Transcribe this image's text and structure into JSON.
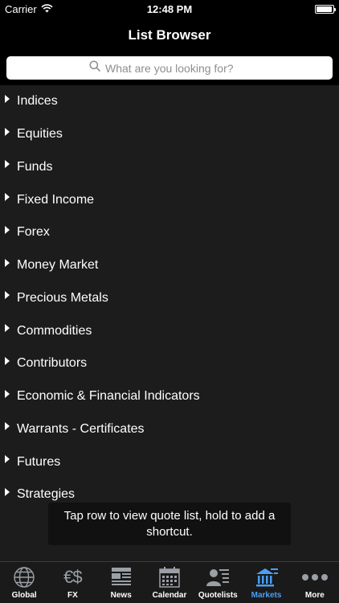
{
  "status": {
    "carrier": "Carrier",
    "time": "12:48 PM",
    "battery_level": 0.95
  },
  "nav": {
    "title": "List Browser"
  },
  "search": {
    "placeholder": "What are you looking for?"
  },
  "list": {
    "items": [
      {
        "label": "Indices"
      },
      {
        "label": "Equities"
      },
      {
        "label": "Funds"
      },
      {
        "label": "Fixed Income"
      },
      {
        "label": "Forex"
      },
      {
        "label": "Money Market"
      },
      {
        "label": "Precious Metals"
      },
      {
        "label": "Commodities"
      },
      {
        "label": "Contributors"
      },
      {
        "label": "Economic & Financial Indicators"
      },
      {
        "label": "Warrants - Certificates"
      },
      {
        "label": "Futures"
      },
      {
        "label": "Strategies"
      }
    ]
  },
  "toast": {
    "text": "Tap row to view quote list, hold to add a shortcut."
  },
  "tabbar": {
    "active_color": "#4a9ff5",
    "tabs": [
      {
        "label": "Global",
        "icon": "globe-icon"
      },
      {
        "label": "FX",
        "icon": "fx-icon",
        "glyph": "€$"
      },
      {
        "label": "News",
        "icon": "news-icon"
      },
      {
        "label": "Calendar",
        "icon": "calendar-icon"
      },
      {
        "label": "Quotelists",
        "icon": "quotelists-icon"
      },
      {
        "label": "Markets",
        "icon": "markets-icon",
        "active": true
      },
      {
        "label": "More",
        "icon": "more-icon"
      }
    ]
  }
}
